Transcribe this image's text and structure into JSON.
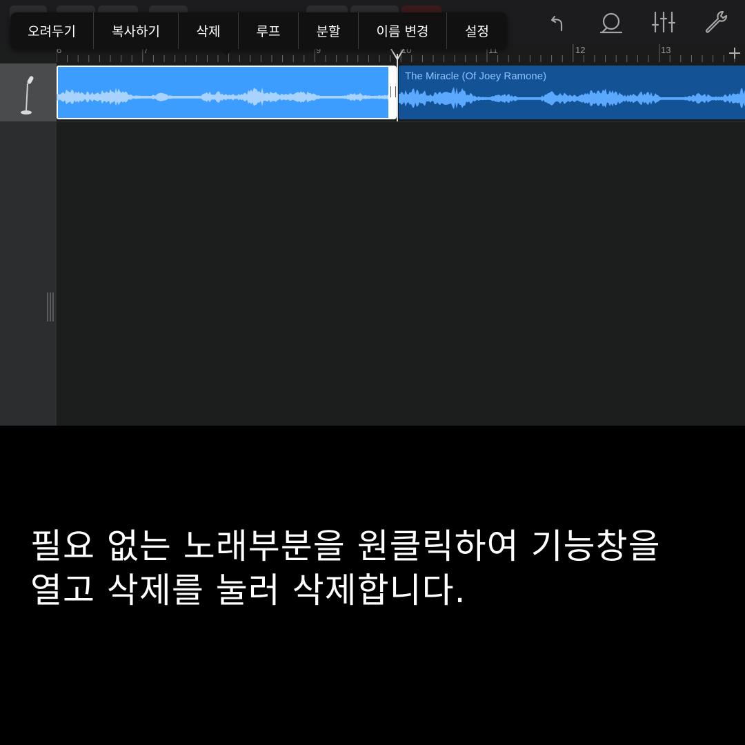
{
  "context_menu": {
    "items": [
      {
        "id": "cut",
        "label": "오려두기"
      },
      {
        "id": "copy",
        "label": "복사하기"
      },
      {
        "id": "delete",
        "label": "삭제"
      },
      {
        "id": "loop",
        "label": "루프"
      },
      {
        "id": "split",
        "label": "분할"
      },
      {
        "id": "rename",
        "label": "이름 변경"
      },
      {
        "id": "settings",
        "label": "설정"
      }
    ]
  },
  "toolbar": {
    "icons": [
      "undo-icon",
      "loop-browser-icon",
      "mixer-icon",
      "wrench-icon"
    ]
  },
  "ruler": {
    "bar_numbers": [
      "6",
      "7",
      "9",
      "10",
      "11",
      "12",
      "13"
    ]
  },
  "track": {
    "instrument_icon": "microphone-icon"
  },
  "regions": {
    "region2_title": "The Miracle (Of Joey Ramone)"
  },
  "caption": {
    "line1": "필요 없는 노래부분을 원클릭하여 기능창을",
    "line2": "열고 삭제를 눌러 삭제합니다."
  },
  "colors": {
    "selected_region": "#3d9dff",
    "region": "#145296",
    "region_title": "#8fc3ff",
    "background": "#000000"
  }
}
